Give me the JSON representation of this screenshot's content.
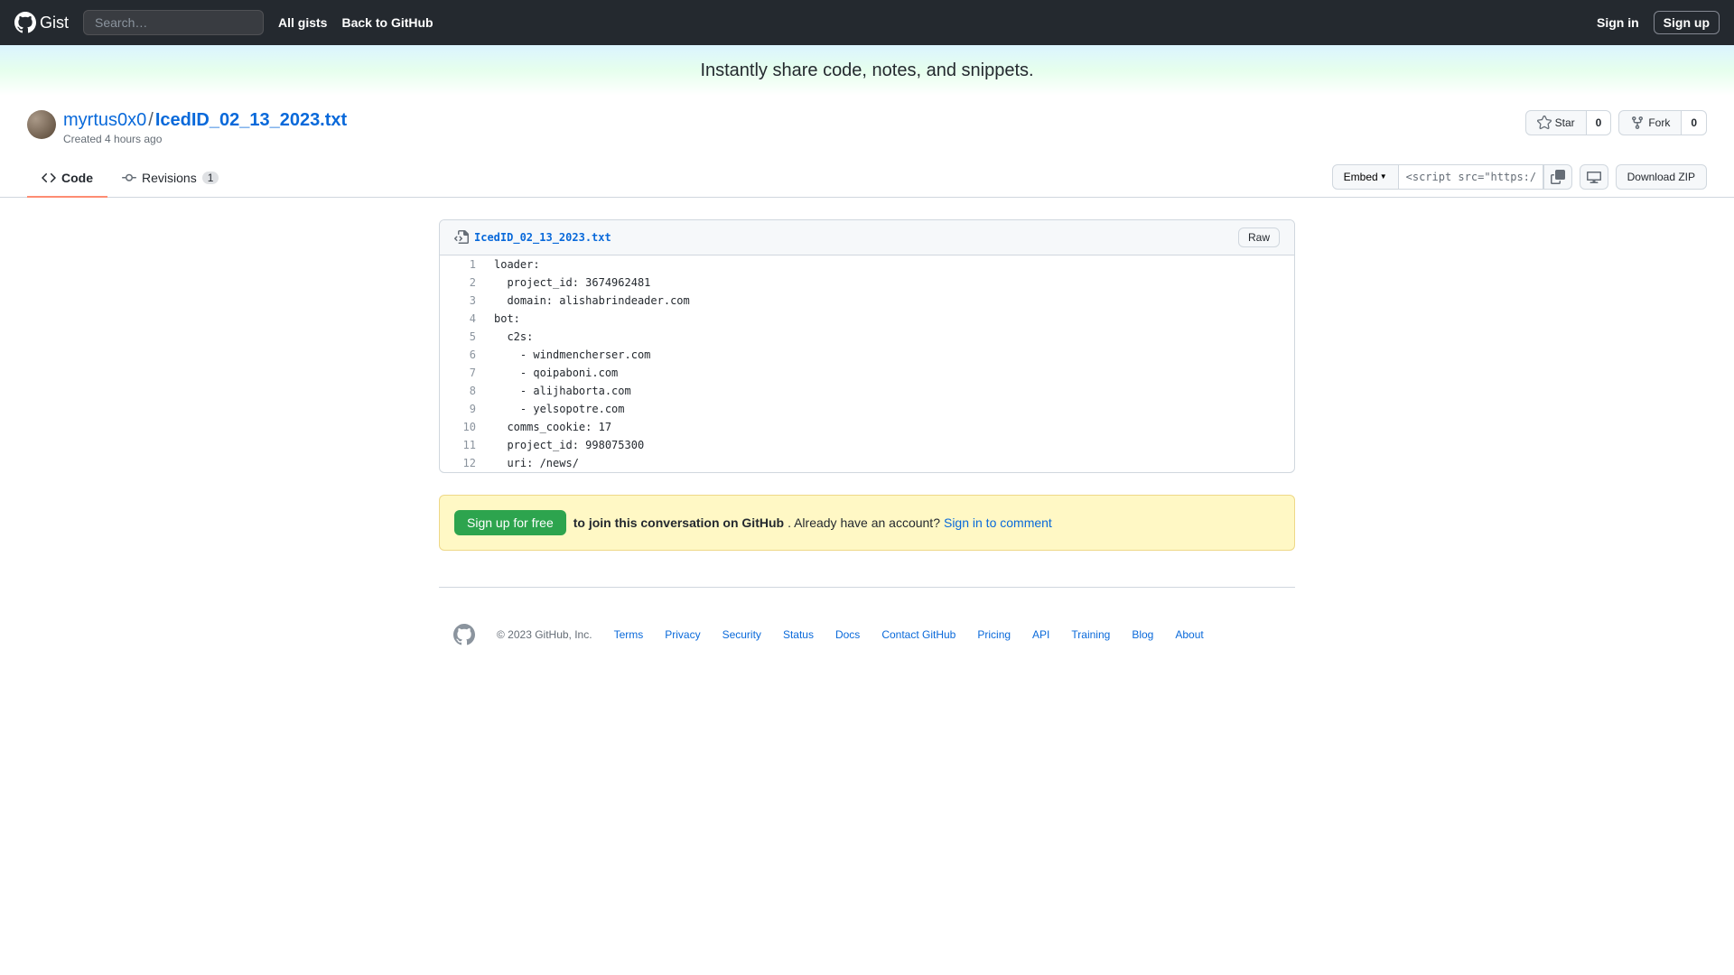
{
  "header": {
    "logo_text": "Gist",
    "search_placeholder": "Search…",
    "nav": {
      "all_gists": "All gists",
      "back": "Back to GitHub"
    },
    "signin": "Sign in",
    "signup": "Sign up"
  },
  "promo": "Instantly share code, notes, and snippets.",
  "gist": {
    "user": "myrtus0x0",
    "separator": "/",
    "filename": "IcedID_02_13_2023.txt",
    "created": "Created 4 hours ago"
  },
  "actions": {
    "star": "Star",
    "star_count": "0",
    "fork": "Fork",
    "fork_count": "0"
  },
  "tabs": {
    "code": "Code",
    "revisions": "Revisions",
    "revisions_count": "1"
  },
  "toolbar": {
    "embed": "Embed",
    "embed_value": "<script src=\"https://g",
    "download": "Download ZIP"
  },
  "file": {
    "name": "IcedID_02_13_2023.txt",
    "raw": "Raw",
    "lines": [
      {
        "n": "1",
        "t": "loader:"
      },
      {
        "n": "2",
        "t": "  project_id: 3674962481"
      },
      {
        "n": "3",
        "t": "  domain: alishabrindeader.com"
      },
      {
        "n": "4",
        "t": "bot:"
      },
      {
        "n": "5",
        "t": "  c2s:"
      },
      {
        "n": "6",
        "t": "    - windmencherser.com"
      },
      {
        "n": "7",
        "t": "    - qoipaboni.com"
      },
      {
        "n": "8",
        "t": "    - alijhaborta.com"
      },
      {
        "n": "9",
        "t": "    - yelsopotre.com"
      },
      {
        "n": "10",
        "t": "  comms_cookie: 17"
      },
      {
        "n": "11",
        "t": "  project_id: 998075300"
      },
      {
        "n": "12",
        "t": "  uri: /news/"
      }
    ]
  },
  "comment": {
    "signup": "Sign up for free",
    "bold": "to join this conversation on GitHub",
    "mid": ". Already have an account? ",
    "signin": "Sign in to comment"
  },
  "footer": {
    "copyright": "© 2023 GitHub, Inc.",
    "links": [
      "Terms",
      "Privacy",
      "Security",
      "Status",
      "Docs",
      "Contact GitHub",
      "Pricing",
      "API",
      "Training",
      "Blog",
      "About"
    ]
  }
}
